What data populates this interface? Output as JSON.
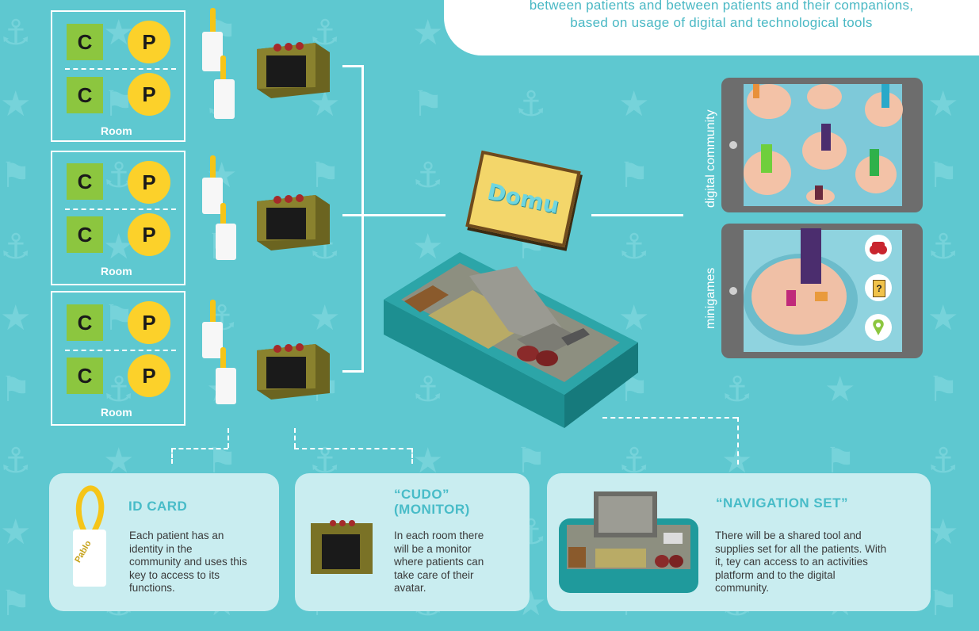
{
  "header": {
    "line1": "between patients and between patients and their companions,",
    "line2": "based on usage of digital and technological tools"
  },
  "rooms": [
    {
      "label": "Room",
      "companion": "C",
      "patient": "P"
    },
    {
      "label": "Room",
      "companion": "C",
      "patient": "P"
    },
    {
      "label": "Room",
      "companion": "C",
      "patient": "P"
    }
  ],
  "box_logo": "Domu",
  "tablets": {
    "community_label": "digital community",
    "minigames_label": "minigames",
    "hint_icon": "?"
  },
  "cards": {
    "id_card": {
      "title": "ID CARD",
      "tag_name": "Pablo",
      "body": [
        "Each patient has an",
        "identity in the",
        "community and uses this",
        "key to access to its",
        "functions."
      ]
    },
    "cudo": {
      "title_line1": "“CUDO”",
      "title_line2": "(MONITOR)",
      "body": [
        "In each room there",
        "will be a monitor",
        "where patients can",
        "take care of their",
        "avatar."
      ]
    },
    "navigation": {
      "title": "“NAVIGATION SET”",
      "body": [
        "There will be a shared tool and",
        "supplies set for all the patients. With",
        "it, tey can access to an activities",
        "platform and to the digital",
        "community."
      ]
    }
  },
  "icons": [
    "anchor-icon",
    "palm-tree-icon",
    "star-icon",
    "key-tag-icon",
    "monitor-icon",
    "navigation-box-icon",
    "binoculars-icon",
    "hint-icon",
    "location-pin-icon"
  ],
  "colors": {
    "background": "#5ec8d0",
    "companion": "#8cc63f",
    "patient": "#fcd12a",
    "accent_text": "#48bcc8",
    "box_teal": "#1d8f91",
    "monitor_olive": "#7a7226",
    "card_bg": "#c9edf0"
  }
}
